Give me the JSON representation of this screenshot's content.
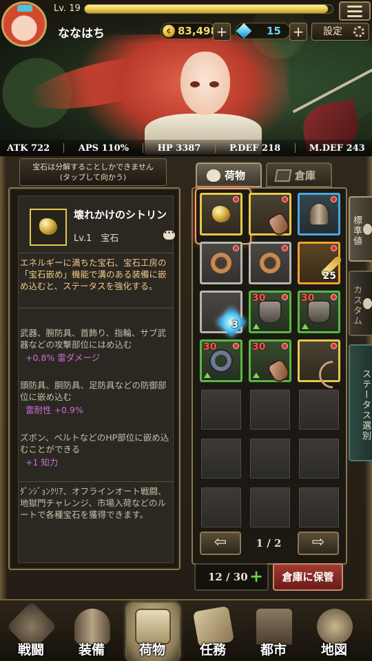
{
  "header": {
    "level_label": "Lv. 19",
    "xp_fraction": 0.98,
    "player_name": "ななはち",
    "gold": "83,498",
    "gems": "15",
    "settings_label": "設定",
    "plus_symbol": "+"
  },
  "stats": [
    {
      "label": "ATK 722"
    },
    {
      "label": "APS 110%"
    },
    {
      "label": "HP 3387"
    },
    {
      "label": "P.DEF 218"
    },
    {
      "label": "M.DEF 243"
    }
  ],
  "tooltip": {
    "line1": "宝石は分解することしかできません",
    "line2": "(タップして向かう)"
  },
  "item_detail": {
    "name": "壊れかけのシトリン",
    "level_type": "Lv.1　宝石",
    "chat_glyph": "•••",
    "description": "エネルギーに満ちた宝石、宝石工房の「宝石嵌め」機能で溝のある装備に嵌め込むと、ステータスを強化する。",
    "slot_weapon_text": "武器、腕防具、首飾り、指輪、サブ武器などの攻撃部位にはめ込む",
    "slot_weapon_effect": "+0.8% 雷ダメージ",
    "slot_armor_text": "頭防具、胴防具、足防具などの防御部位に嵌め込む",
    "slot_armor_effect": "雷耐性 +0.9%",
    "slot_hp_text": "ズボン、ベルトなどのHP部位に嵌め込むことができる",
    "slot_hp_effect": "+1 知力",
    "source_text": "ﾀﾞﾝｼﾞｮﾝｸﾘｱ、オフラインオート戦闘、地獄門チャレンジ、市場入荷などのルートで各種宝石を獲得できます。"
  },
  "inventory": {
    "tabs": [
      {
        "label": "荷物",
        "active": true
      },
      {
        "label": "倉庫",
        "active": false
      }
    ],
    "side_tabs": [
      "標準値",
      "カスタム",
      "ステータス選別"
    ],
    "page_label": "1 / 2",
    "prev_glyph": "⇦",
    "next_glyph": "⇨",
    "capacity": "12 / 30",
    "capacity_plus": "+",
    "store_button": "倉庫に保管",
    "slots": [
      {
        "icon": "gem-icon",
        "rarity": "yellow",
        "dot": true,
        "selected": true
      },
      {
        "icon": "gauntlet-icon",
        "rarity": "yellow",
        "dot": true
      },
      {
        "icon": "helmet-icon",
        "rarity": "blue",
        "dot": true
      },
      {
        "icon": "ring-icon",
        "rarity": "gray",
        "dot": true
      },
      {
        "icon": "ring-icon",
        "rarity": "gray",
        "dot": true
      },
      {
        "icon": "key-icon",
        "rarity": "orange",
        "dot": true,
        "qty": "25"
      },
      {
        "icon": "crystal-icon",
        "rarity": "gray",
        "qty": "3"
      },
      {
        "icon": "armor-icon",
        "rarity": "green",
        "dot": true,
        "level": "30",
        "up": true
      },
      {
        "icon": "armor-icon",
        "rarity": "green",
        "dot": true,
        "level": "30",
        "up": true
      },
      {
        "icon": "ring-icon",
        "rarity": "green",
        "dot": true,
        "level": "30",
        "up": true
      },
      {
        "icon": "gauntlet-icon",
        "rarity": "green",
        "dot": true,
        "level": "30",
        "up": true
      },
      {
        "icon": "bow-icon",
        "rarity": "yellow",
        "dot": true
      }
    ]
  },
  "bottom_nav": [
    {
      "label": "戦闘",
      "active": false
    },
    {
      "label": "装備",
      "active": false
    },
    {
      "label": "荷物",
      "active": true
    },
    {
      "label": "任務",
      "active": false
    },
    {
      "label": "都市",
      "active": false
    },
    {
      "label": "地図",
      "active": false
    }
  ]
}
